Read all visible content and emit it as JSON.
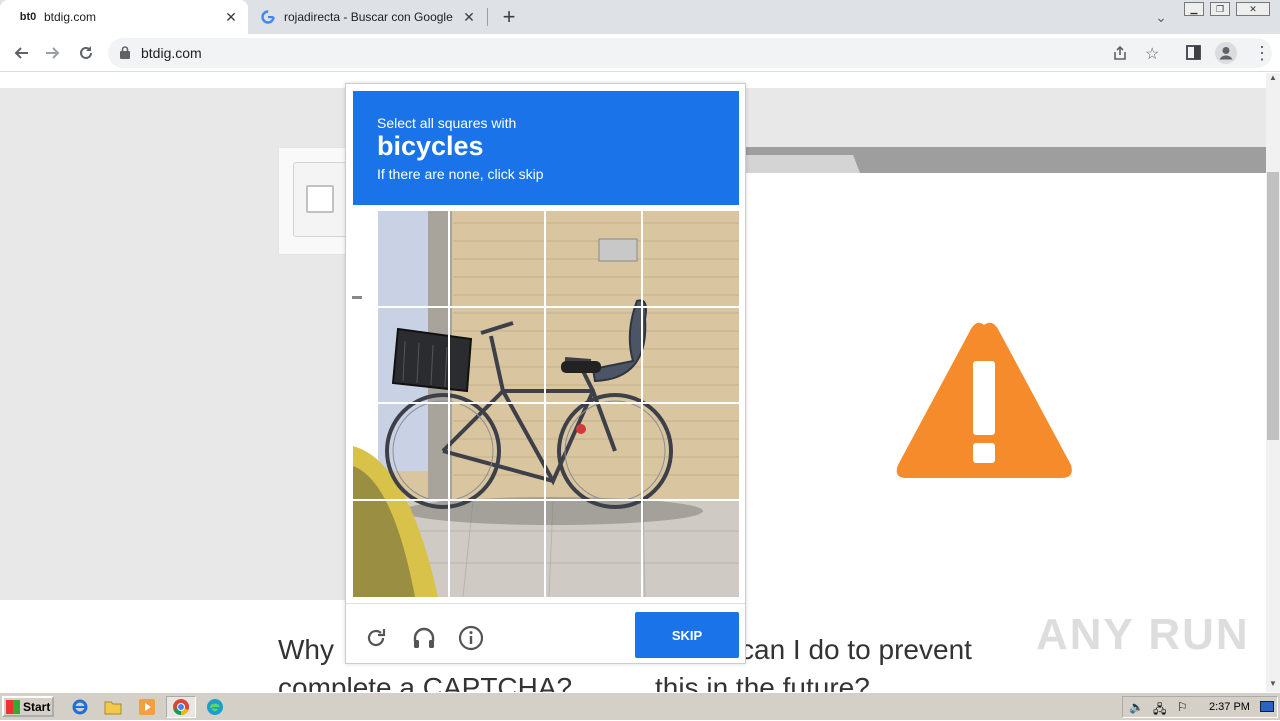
{
  "browser": {
    "tabs": [
      {
        "favicon": "bt0",
        "title": "btdig.com",
        "active": true
      },
      {
        "favicon": "G",
        "title": "rojadirecta - Buscar con Google",
        "active": false
      }
    ],
    "new_tab_glyph": "+",
    "url": "btdig.com"
  },
  "page": {
    "why_text": "Why",
    "complete_text": "complete a CAPTCHA?",
    "can_text": "can I do to prevent",
    "future_text": "this in the future?",
    "warning_color": "#f58b2a"
  },
  "captcha": {
    "instruction": "Select all squares with",
    "target": "bicycles",
    "hint": "If there are none, click skip",
    "skip_label": "SKIP",
    "accent_color": "#1a73e8",
    "grid_rows": 4,
    "grid_cols": 4
  },
  "taskbar": {
    "start_label": "Start",
    "clock": "2:37 PM"
  },
  "watermark": "ANY RUN"
}
